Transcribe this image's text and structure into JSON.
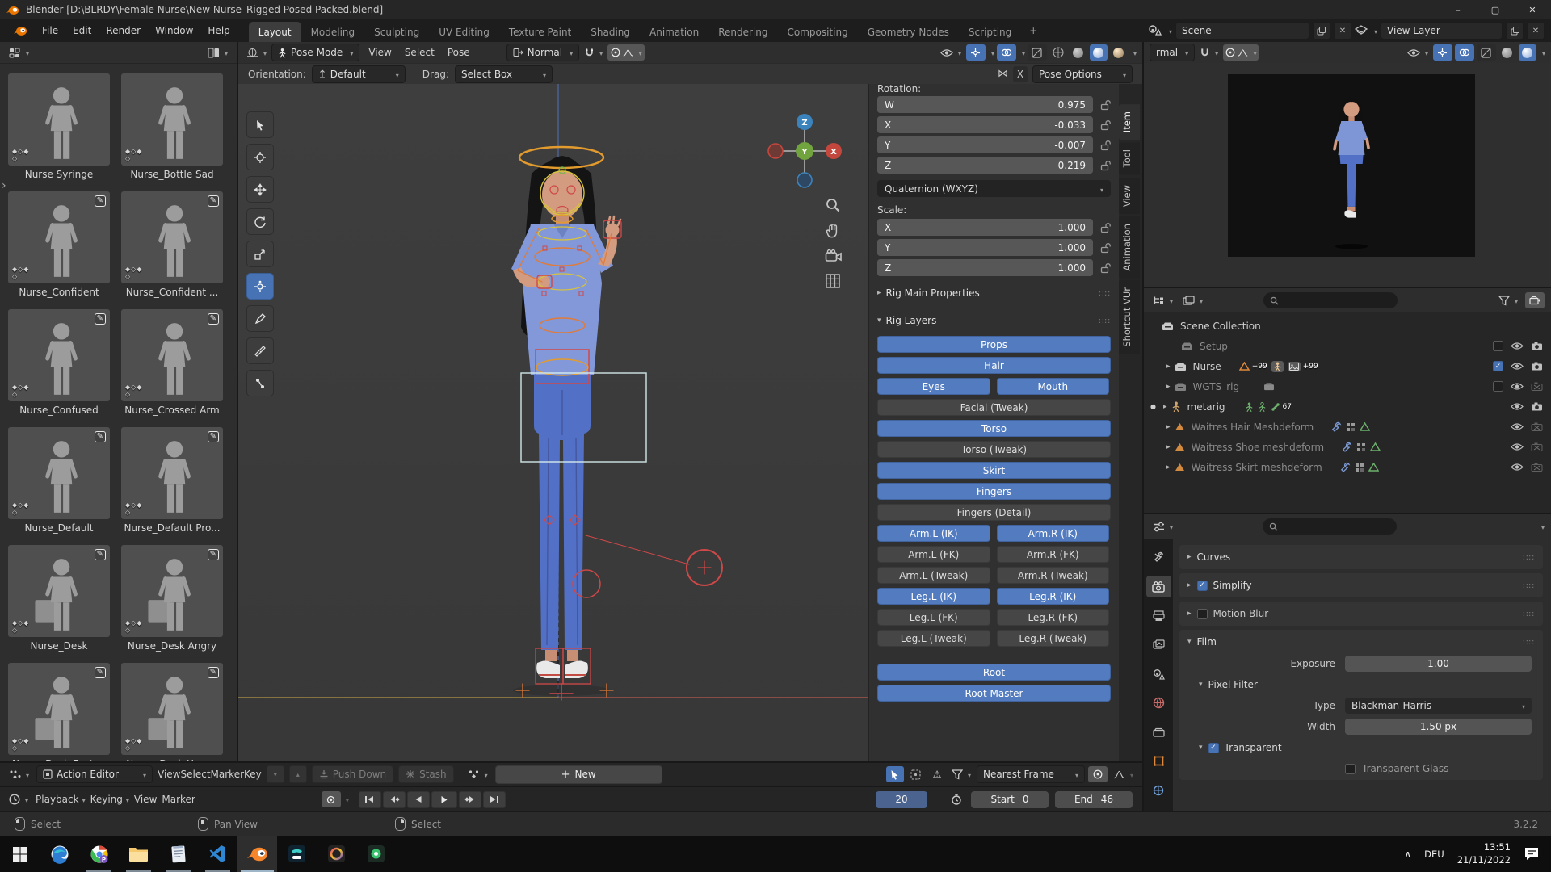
{
  "window": {
    "title": "Blender [D:\\BLRDY\\Female Nurse\\New Nurse_Rigged Posed Packed.blend]",
    "minimize": "–",
    "maximize": "▢",
    "close": "✕"
  },
  "topbar": {
    "menus": [
      "File",
      "Edit",
      "Render",
      "Window",
      "Help"
    ],
    "tabs": [
      {
        "label": "Layout",
        "active": true
      },
      {
        "label": "Modeling"
      },
      {
        "label": "Sculpting"
      },
      {
        "label": "UV Editing"
      },
      {
        "label": "Texture Paint"
      },
      {
        "label": "Shading"
      },
      {
        "label": "Animation"
      },
      {
        "label": "Rendering"
      },
      {
        "label": "Compositing"
      },
      {
        "label": "Geometry Nodes"
      },
      {
        "label": "Scripting"
      }
    ],
    "add_tab": "+",
    "scene": "Scene",
    "view_layer": "View Layer"
  },
  "asset_browser": {
    "assets": [
      {
        "name": "Nurse Syringe"
      },
      {
        "name": "Nurse_Bottle Sad"
      },
      {
        "name": "Nurse_Confident",
        "pencil": true
      },
      {
        "name": "Nurse_Confident ...",
        "pencil": true
      },
      {
        "name": "Nurse_Confused",
        "pencil": true
      },
      {
        "name": "Nurse_Crossed Arm",
        "pencil": true
      },
      {
        "name": "Nurse_Default",
        "pencil": true
      },
      {
        "name": "Nurse_Default Pro...",
        "pencil": true
      },
      {
        "name": "Nurse_Desk",
        "pencil": true,
        "desk": true
      },
      {
        "name": "Nurse_Desk Angry",
        "pencil": true,
        "desk": true
      },
      {
        "name": "Nurse_Desk Foot ...",
        "pencil": true,
        "desk": true
      },
      {
        "name": "Nurse_Desk Happy",
        "pencil": true,
        "desk": true
      }
    ]
  },
  "viewport": {
    "mode": "Pose Mode",
    "menus": [
      "View",
      "Select",
      "Pose"
    ],
    "orientation_label": "Orientation:",
    "orientation_value": "Default",
    "drag_label": "Drag:",
    "drag_value": "Select Box",
    "transform_orientation": "Normal",
    "mirror_x": "X",
    "pose_options": "Pose Options",
    "gizmo": {
      "x": "X",
      "y": "Y",
      "z": "Z"
    }
  },
  "sidebar": {
    "tabs": [
      {
        "label": "Item",
        "active": true
      },
      {
        "label": "Tool"
      },
      {
        "label": "View"
      },
      {
        "label": "Animation"
      },
      {
        "label": "Shortcut VUr"
      }
    ],
    "rotation_label": "Rotation:",
    "rotation": [
      {
        "axis": "W",
        "value": "0.975"
      },
      {
        "axis": "X",
        "value": "-0.033"
      },
      {
        "axis": "Y",
        "value": "-0.007"
      },
      {
        "axis": "Z",
        "value": "0.219"
      }
    ],
    "rotation_mode": "Quaternion (WXYZ)",
    "scale_label": "Scale:",
    "scale": [
      {
        "axis": "X",
        "value": "1.000"
      },
      {
        "axis": "Y",
        "value": "1.000"
      },
      {
        "axis": "Z",
        "value": "1.000"
      }
    ],
    "rig_main": "Rig Main Properties",
    "rig_layers": "Rig Layers",
    "rig_buttons": [
      {
        "label": "Props",
        "on": true
      },
      {
        "label": "Hair",
        "on": true
      },
      {
        "label": "Eyes",
        "on": true,
        "half": true
      },
      {
        "label": "Mouth",
        "on": true,
        "half": true
      },
      {
        "label": "Facial (Tweak)"
      },
      {
        "label": "Torso",
        "on": true
      },
      {
        "label": "Torso (Tweak)"
      },
      {
        "label": "Skirt",
        "on": true
      },
      {
        "label": "Fingers",
        "on": true
      },
      {
        "label": "Fingers (Detail)"
      },
      {
        "label": "Arm.L (IK)",
        "on": true,
        "half": true
      },
      {
        "label": "Arm.R (IK)",
        "on": true,
        "half": true
      },
      {
        "label": "Arm.L (FK)",
        "half": true
      },
      {
        "label": "Arm.R (FK)",
        "half": true
      },
      {
        "label": "Arm.L (Tweak)",
        "half": true
      },
      {
        "label": "Arm.R (Tweak)",
        "half": true
      },
      {
        "label": "Leg.L (IK)",
        "on": true,
        "half": true
      },
      {
        "label": "Leg.R (IK)",
        "on": true,
        "half": true
      },
      {
        "label": "Leg.L (FK)",
        "half": true
      },
      {
        "label": "Leg.R (FK)",
        "half": true
      },
      {
        "label": "Leg.L (Tweak)",
        "half": true
      },
      {
        "label": "Leg.R (Tweak)",
        "half": true
      },
      {
        "label": "Root",
        "on": true,
        "gap": true
      },
      {
        "label": "Root Master",
        "on": true
      }
    ]
  },
  "outliner": {
    "scene_collection": "Scene Collection",
    "setup": "Setup",
    "nurse": "Nurse",
    "nurse_count1": "+99",
    "nurse_count2": "+99",
    "wgts": "WGTS_rig",
    "metarig": "metarig",
    "metarig_count": "67",
    "hair": "Waitres Hair Meshdeform",
    "shoe": "Waitress Shoe meshdeform",
    "skirt": "Waitress Skirt meshdeform"
  },
  "properties": {
    "curves": "Curves",
    "simplify": "Simplify",
    "motion_blur": "Motion Blur",
    "film": "Film",
    "exposure_label": "Exposure",
    "exposure_value": "1.00",
    "pixel_filter": "Pixel Filter",
    "type_label": "Type",
    "type_value": "Blackman-Harris",
    "width_label": "Width",
    "width_value": "1.50 px",
    "transparent": "Transparent",
    "transparent_glass": "Transparent Glass"
  },
  "dopesheet": {
    "editor": "Action Editor",
    "menus": [
      "View",
      "Select",
      "Marker",
      "Key"
    ],
    "push_down": "Push Down",
    "stash": "Stash",
    "new_button": "New",
    "snap": "Nearest Frame"
  },
  "timeline": {
    "playback": "Playback",
    "keying": "Keying",
    "view": "View",
    "marker": "Marker",
    "frame": "20",
    "start_label": "Start",
    "start": "0",
    "end_label": "End",
    "end": "46"
  },
  "preview": {
    "normal_truncated": "rmal"
  },
  "statusbar": {
    "items": [
      {
        "label": "Select",
        "btn": "l"
      },
      {
        "label": "Pan View",
        "btn": "m"
      },
      {
        "label": "Select",
        "btn": "r"
      }
    ],
    "version": "3.2.2"
  },
  "taskbar": {
    "lang": "DEU",
    "time": "13:51",
    "date": "21/11/2022"
  },
  "icons": {
    "edit-badge": "✎",
    "warning": "⚠",
    "mirror": "⋈",
    "expand-right": "›",
    "caret-down": "▾",
    "chevron-up": "∧"
  },
  "colors": {
    "accent": "#4772b3",
    "blender_orange": "#ea7600",
    "button_on": "#527cbf"
  }
}
